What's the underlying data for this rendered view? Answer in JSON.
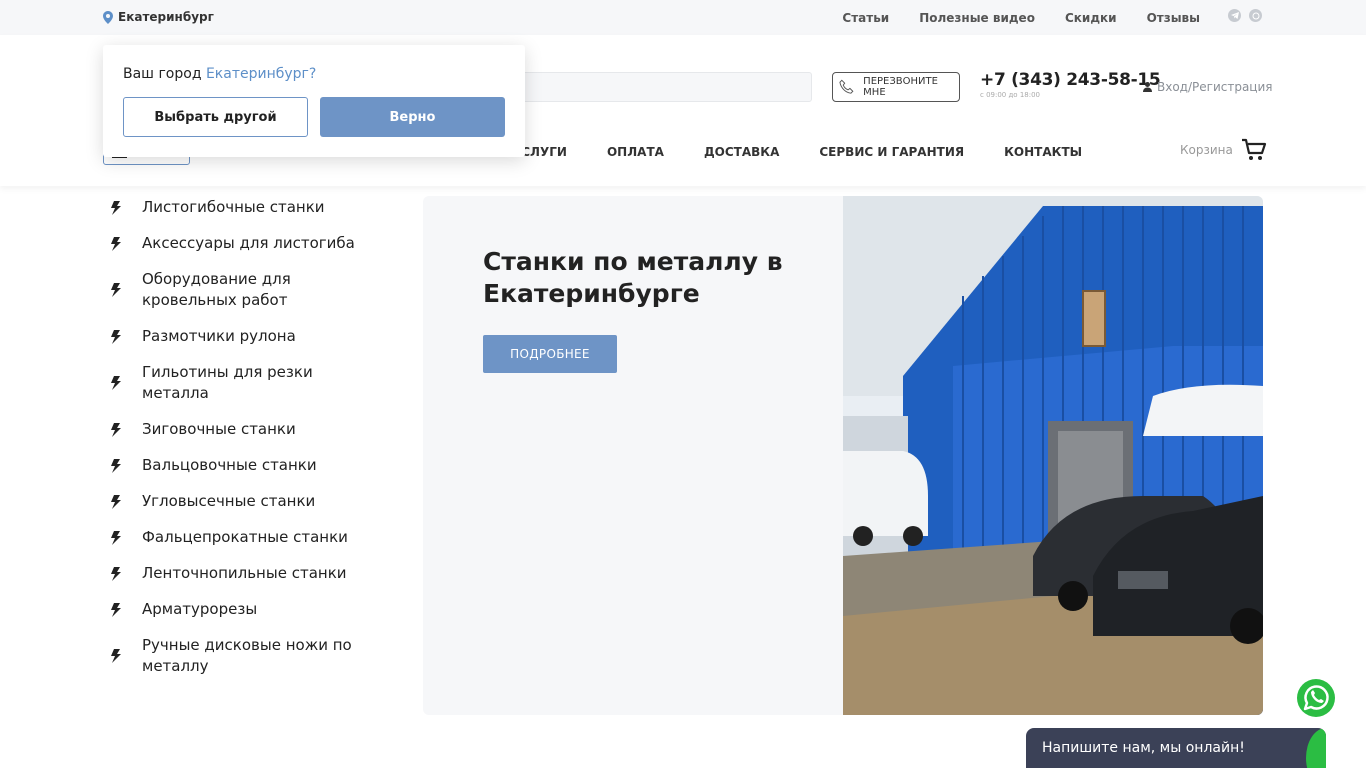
{
  "topbar": {
    "city": "Екатеринбург",
    "links": [
      "Статьи",
      "Полезные видео",
      "Скидки",
      "Отзывы"
    ]
  },
  "header": {
    "callback_label": "ПЕРЕЗВОНИТЕ МНЕ",
    "phone": "+7 (343) 243-58-15",
    "hours": "с 09:00 до 18:00",
    "login": "Вход/Регистрация",
    "nav": [
      "УСЛУГИ",
      "ОПЛАТА",
      "ДОСТАВКА",
      "СЕРВИС И ГАРАНТИЯ",
      "КОНТАКТЫ"
    ],
    "cart": "Корзина"
  },
  "city_popup": {
    "question": "Ваш город",
    "city": "Екатеринбург?",
    "choose_other": "Выбрать другой",
    "confirm": "Верно"
  },
  "sidebar": {
    "items": [
      "Листогибочные станки",
      "Аксессуары для листогиба",
      "Оборудование для кровельных работ",
      "Размотчики рулона",
      "Гильотины для резки металла",
      "Зиговочные станки",
      "Вальцовочные станки",
      "Угловысечные станки",
      "Фальцепрокатные станки",
      "Ленточнопильные станки",
      "Арматурорезы",
      "Ручные дисковые ножи по металлу"
    ]
  },
  "hero": {
    "title": "Станки по металлу в Екатеринбурге",
    "button": "ПОДРОБНЕЕ"
  },
  "chat": {
    "text": "Напишите нам, мы онлайн!"
  },
  "colors": {
    "accent": "#6e94c6",
    "whatsapp": "#2bbd43",
    "chat_bg": "#3b4157"
  }
}
